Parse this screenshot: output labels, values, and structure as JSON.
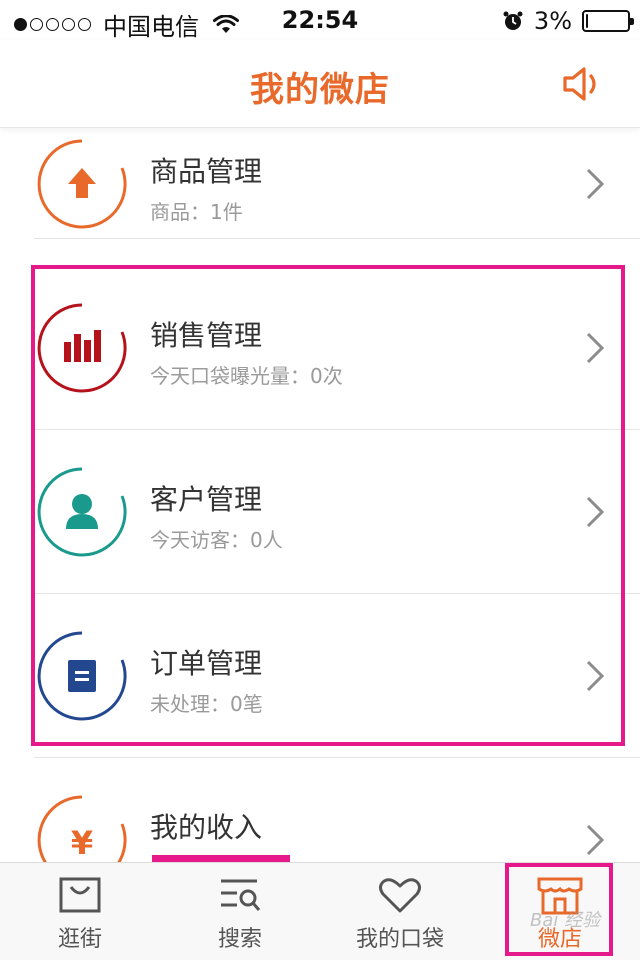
{
  "status_bar": {
    "carrier": "中国电信",
    "time": "22:54",
    "battery_percent": "3%",
    "battery_level": 0.03,
    "signal_filled": 1,
    "signal_total": 5,
    "icons": [
      "wifi-icon",
      "alarm-icon",
      "battery-icon"
    ]
  },
  "header": {
    "title": "我的微店",
    "right_icon": "speaker-icon",
    "accent_color": "#e8692a"
  },
  "rows": [
    {
      "title": "商品管理",
      "subtitle": "商品：1件",
      "icon": "upload-arrow-icon",
      "color": "#e8692a"
    },
    {
      "title": "销售管理",
      "subtitle": "今天口袋曝光量：0次",
      "icon": "bar-chart-icon",
      "color": "#b5121b"
    },
    {
      "title": "客户管理",
      "subtitle": "今天访客：0人",
      "icon": "person-icon",
      "color": "#1a9a8c"
    },
    {
      "title": "订单管理",
      "subtitle": "未处理：0笔",
      "icon": "document-icon",
      "color": "#23488f"
    },
    {
      "title": "我的收入",
      "subtitle": "",
      "icon": "yen-icon",
      "color": "#e8692a"
    }
  ],
  "tabs": [
    {
      "label": "逛街",
      "icon": "shopping-bag-icon",
      "active": false
    },
    {
      "label": "搜索",
      "icon": "search-list-icon",
      "active": false
    },
    {
      "label": "我的口袋",
      "icon": "heart-icon",
      "active": false
    },
    {
      "label": "微店",
      "icon": "shop-icon",
      "active": true
    }
  ],
  "highlight_color": "#e6198a",
  "watermark": "Bai 经验"
}
